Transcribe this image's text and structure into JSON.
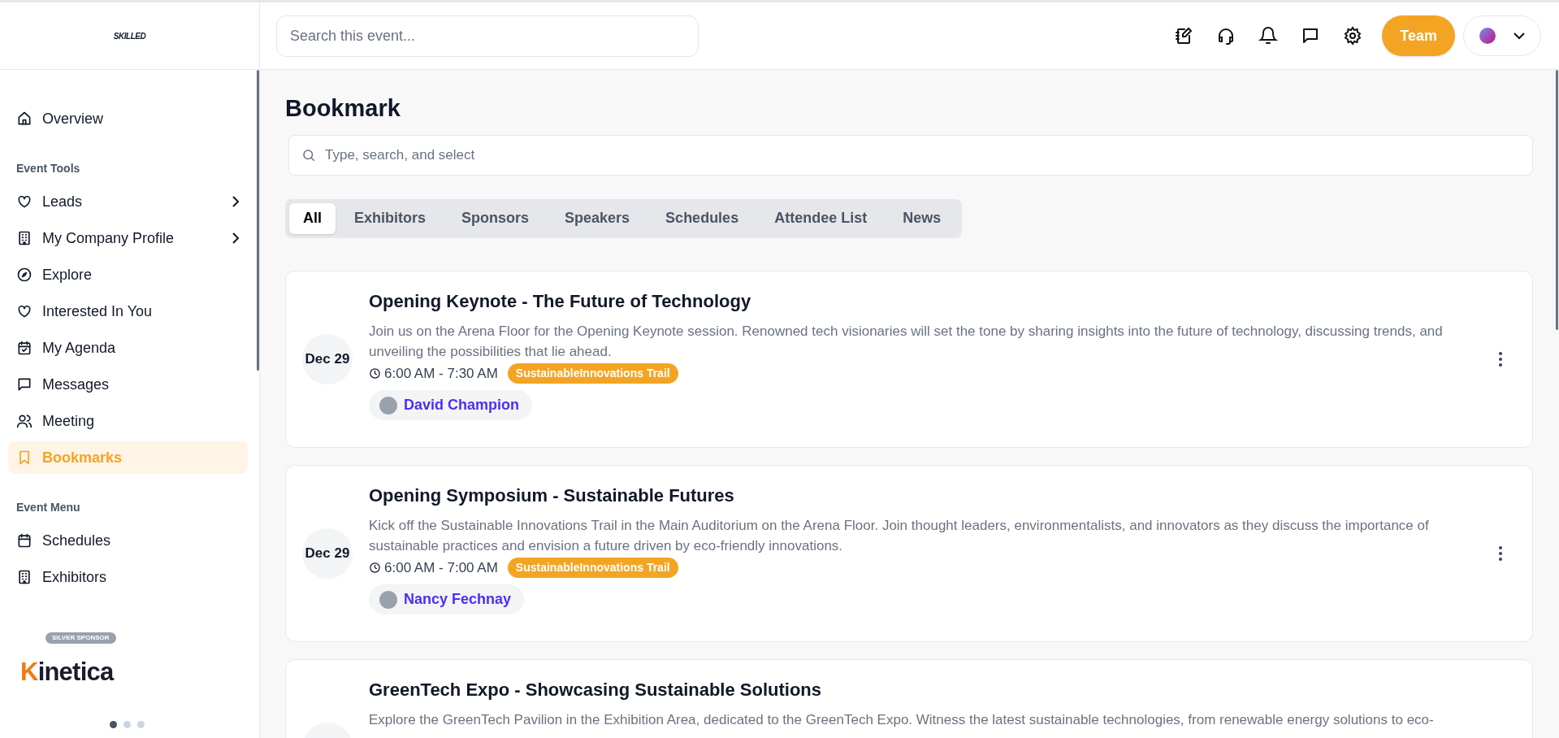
{
  "logo": {
    "text": "SKILLED"
  },
  "header": {
    "search_placeholder": "Search this event...",
    "team_button": "Team"
  },
  "sidebar": {
    "items": [
      {
        "kind": "item",
        "label": "Overview",
        "selected": false,
        "chevron": false
      },
      {
        "kind": "section",
        "label": "Event Tools"
      },
      {
        "kind": "item",
        "label": "Leads",
        "selected": false,
        "chevron": true
      },
      {
        "kind": "item",
        "label": "My Company Profile",
        "selected": false,
        "chevron": true
      },
      {
        "kind": "item",
        "label": "Explore",
        "selected": false,
        "chevron": false
      },
      {
        "kind": "item",
        "label": "Interested In You",
        "selected": false,
        "chevron": false
      },
      {
        "kind": "item",
        "label": "My Agenda",
        "selected": false,
        "chevron": false
      },
      {
        "kind": "item",
        "label": "Messages",
        "selected": false,
        "chevron": false
      },
      {
        "kind": "item",
        "label": "Meeting",
        "selected": false,
        "chevron": false
      },
      {
        "kind": "item",
        "label": "Bookmarks",
        "selected": true,
        "chevron": false
      },
      {
        "kind": "section",
        "label": "Event Menu"
      },
      {
        "kind": "item",
        "label": "Schedules",
        "selected": false,
        "chevron": false
      },
      {
        "kind": "item",
        "label": "Exhibitors",
        "selected": false,
        "chevron": false
      }
    ],
    "sponsor": {
      "badge": "SILVER SPONSOR",
      "name_lead": "K",
      "name_rest": "inetica"
    },
    "carousel_dots": [
      {
        "selected": true
      },
      {
        "selected": false
      },
      {
        "selected": false
      }
    ]
  },
  "page": {
    "title": "Bookmark",
    "search_placeholder": "Type, search, and select",
    "tabs": [
      {
        "label": "All",
        "selected": true
      },
      {
        "label": "Exhibitors",
        "selected": false
      },
      {
        "label": "Sponsors",
        "selected": false
      },
      {
        "label": "Speakers",
        "selected": false
      },
      {
        "label": "Schedules",
        "selected": false
      },
      {
        "label": "Attendee List",
        "selected": false
      },
      {
        "label": "News",
        "selected": false
      }
    ],
    "events": [
      {
        "date": "Dec 29",
        "title": "Opening Keynote - The Future of Technology",
        "description": "Join us on the Arena Floor for the Opening Keynote session. Renowned tech visionaries will set the tone by sharing insights into the future of technology, discussing trends, and unveiling the possibilities that lie ahead.",
        "time": "6:00 AM - 7:30 AM",
        "tag": "SustainableInnovations Trail",
        "speaker": "David Champion"
      },
      {
        "date": "Dec 29",
        "title": "Opening Symposium - Sustainable Futures",
        "description": "Kick off the Sustainable Innovations Trail in the Main Auditorium on the Arena Floor. Join thought leaders, environmentalists, and innovators as they discuss the importance of sustainable practices and envision a future driven by eco-friendly innovations.",
        "time": "6:00 AM - 7:00 AM",
        "tag": "SustainableInnovations Trail",
        "speaker": "Nancy Fechnay"
      },
      {
        "title": "GreenTech Expo - Showcasing Sustainable Solutions",
        "description": "Explore the GreenTech Pavilion in the Exhibition Area, dedicated to the GreenTech Expo. Witness the latest sustainable technologies, from renewable energy solutions to eco-"
      }
    ]
  }
}
